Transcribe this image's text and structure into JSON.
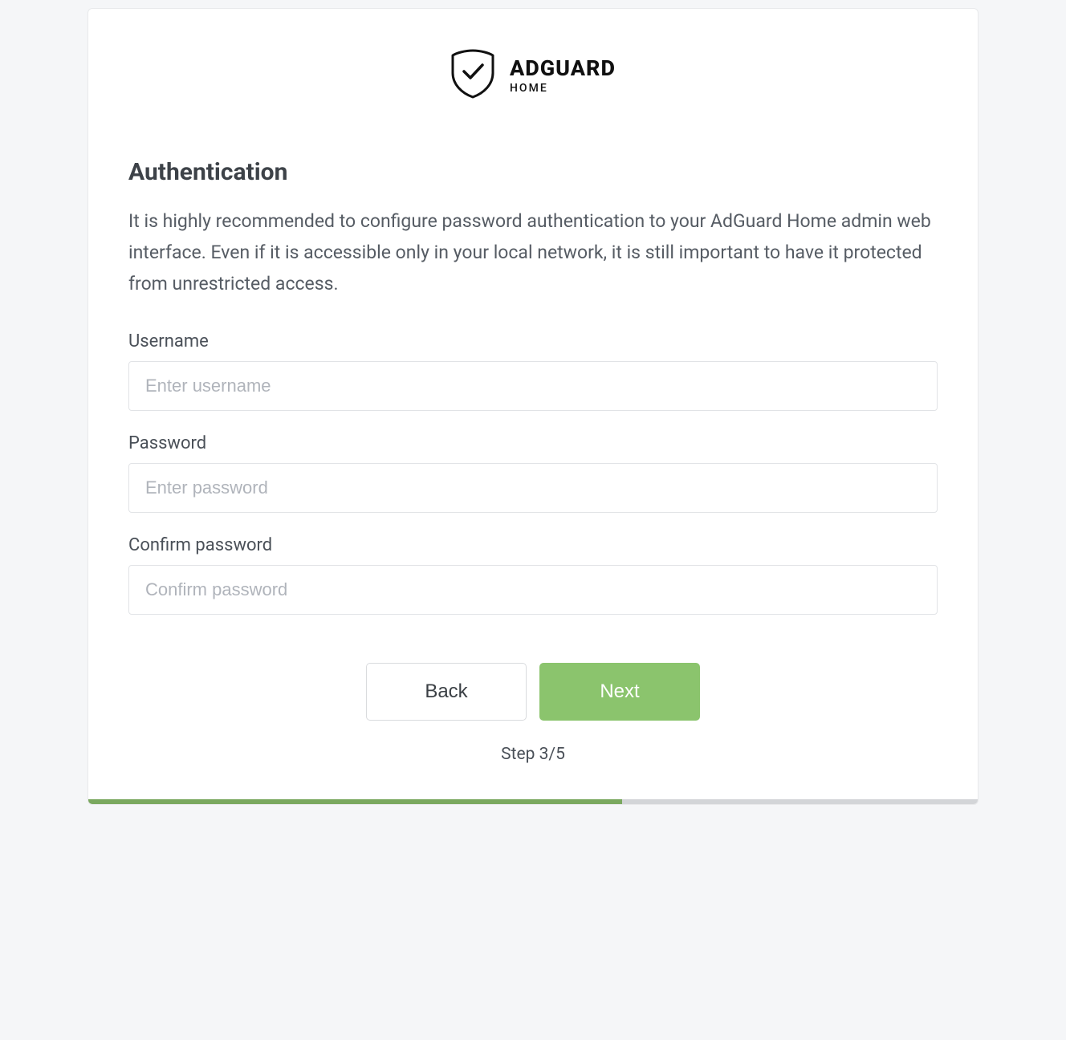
{
  "logo": {
    "title": "ADGUARD",
    "subtitle": "HOME"
  },
  "heading": "Authentication",
  "description": "It is highly recommended to configure password authentication to your AdGuard Home admin web interface. Even if it is accessible only in your local network, it is still important to have it protected from unrestricted access.",
  "form": {
    "username": {
      "label": "Username",
      "placeholder": "Enter username",
      "value": ""
    },
    "password": {
      "label": "Password",
      "placeholder": "Enter password",
      "value": ""
    },
    "confirm": {
      "label": "Confirm password",
      "placeholder": "Confirm password",
      "value": ""
    }
  },
  "buttons": {
    "back": "Back",
    "next": "Next"
  },
  "step": {
    "label": "Step 3/5",
    "current": 3,
    "total": 5,
    "progress_percent": "60%"
  }
}
